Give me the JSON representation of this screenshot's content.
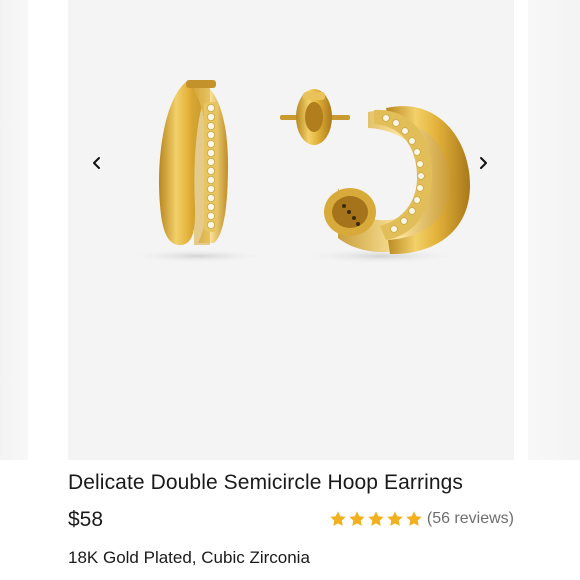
{
  "product": {
    "title": "Delicate Double Semicircle Hoop Earrings",
    "price": "$58",
    "rating_value": 5,
    "rating_max": 5,
    "reviews": "(56 reviews)",
    "material": "18K Gold Plated, Cubic Zirconia"
  },
  "gallery": {
    "prev_icon": "chevron-left-icon",
    "next_icon": "chevron-right-icon"
  },
  "colors": {
    "star": "#F2B01E",
    "gold": "#E1B43A",
    "background": "#F4F4F4"
  }
}
